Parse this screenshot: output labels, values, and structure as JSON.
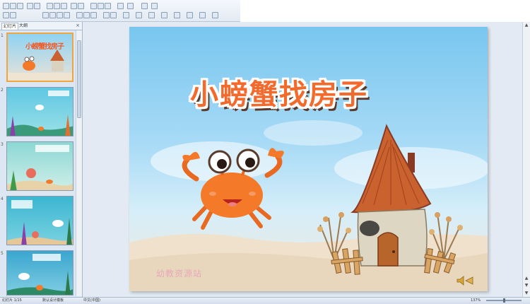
{
  "slide": {
    "title": "小螃蟹找房子",
    "watermark": "幼教资源站"
  },
  "pane": {
    "tabs": [
      "幻灯片",
      "大纲"
    ],
    "close": "×",
    "thumbs": [
      {
        "num": "1",
        "title": "小螃蟹找房子"
      },
      {
        "num": "2"
      },
      {
        "num": "3"
      },
      {
        "num": "4"
      },
      {
        "num": "5"
      }
    ]
  },
  "status": {
    "slide_info": "幻灯片 1/15",
    "theme": "默认设计模板",
    "language": "中文(中国)",
    "zoom": "137%"
  },
  "colors": {
    "title": "#f26a2c",
    "crab": "#f47a2a",
    "sky_top": "#78c6ef",
    "sand": "#f1e7da"
  }
}
